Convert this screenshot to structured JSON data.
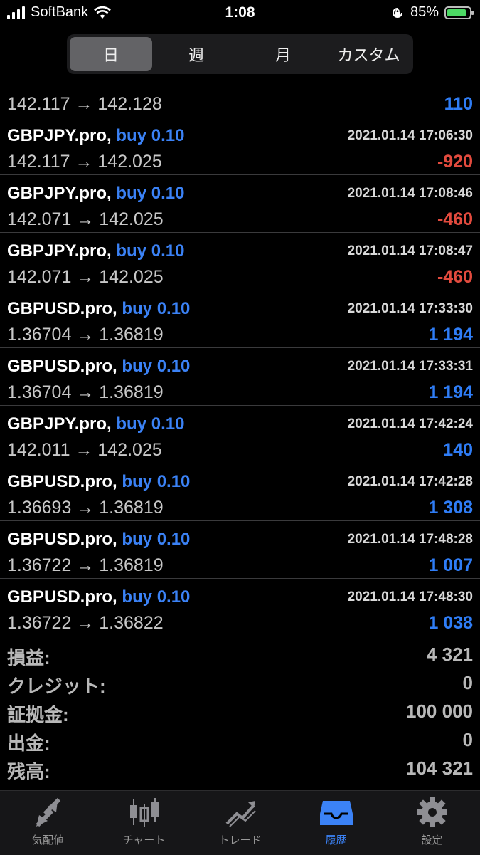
{
  "status": {
    "carrier": "SoftBank",
    "time": "1:08",
    "battery": "85%"
  },
  "period_tabs": [
    "日",
    "週",
    "月",
    "カスタム"
  ],
  "partial_row": {
    "price": "142.117 → 142.128",
    "profit": "110"
  },
  "deals": [
    {
      "symbol": "GBPJPY.pro,",
      "side": "buy 0.10",
      "date": "2021.01.14 17:06:30",
      "price": "142.117 → 142.025",
      "profit": "-920",
      "sign": "neg"
    },
    {
      "symbol": "GBPJPY.pro,",
      "side": "buy 0.10",
      "date": "2021.01.14 17:08:46",
      "price": "142.071 → 142.025",
      "profit": "-460",
      "sign": "neg"
    },
    {
      "symbol": "GBPJPY.pro,",
      "side": "buy 0.10",
      "date": "2021.01.14 17:08:47",
      "price": "142.071 → 142.025",
      "profit": "-460",
      "sign": "neg"
    },
    {
      "symbol": "GBPUSD.pro,",
      "side": "buy 0.10",
      "date": "2021.01.14 17:33:30",
      "price": "1.36704 → 1.36819",
      "profit": "1 194",
      "sign": "pos"
    },
    {
      "symbol": "GBPUSD.pro,",
      "side": "buy 0.10",
      "date": "2021.01.14 17:33:31",
      "price": "1.36704 → 1.36819",
      "profit": "1 194",
      "sign": "pos"
    },
    {
      "symbol": "GBPJPY.pro,",
      "side": "buy 0.10",
      "date": "2021.01.14 17:42:24",
      "price": "142.011 → 142.025",
      "profit": "140",
      "sign": "pos"
    },
    {
      "symbol": "GBPUSD.pro,",
      "side": "buy 0.10",
      "date": "2021.01.14 17:42:28",
      "price": "1.36693 → 1.36819",
      "profit": "1 308",
      "sign": "pos"
    },
    {
      "symbol": "GBPUSD.pro,",
      "side": "buy 0.10",
      "date": "2021.01.14 17:48:28",
      "price": "1.36722 → 1.36819",
      "profit": "1 007",
      "sign": "pos"
    },
    {
      "symbol": "GBPUSD.pro,",
      "side": "buy 0.10",
      "date": "2021.01.14 17:48:30",
      "price": "1.36722 → 1.36822",
      "profit": "1 038",
      "sign": "pos"
    }
  ],
  "summary": [
    {
      "label": "損益:",
      "value": "4 321"
    },
    {
      "label": "クレジット:",
      "value": "0"
    },
    {
      "label": "証拠金:",
      "value": "100 000"
    },
    {
      "label": "出金:",
      "value": "0"
    },
    {
      "label": "残高:",
      "value": "104 321"
    }
  ],
  "tabs": [
    {
      "label": "気配値",
      "icon": "quotes-arrows-icon"
    },
    {
      "label": "チャート",
      "icon": "candlestick-chart-icon"
    },
    {
      "label": "トレード",
      "icon": "trade-trend-icon"
    },
    {
      "label": "履歴",
      "icon": "history-inbox-icon"
    },
    {
      "label": "設定",
      "icon": "gear-icon"
    }
  ],
  "colors": {
    "accent": "#3b82f6",
    "positive": "#2f7df6",
    "negative": "#e34b3e"
  }
}
